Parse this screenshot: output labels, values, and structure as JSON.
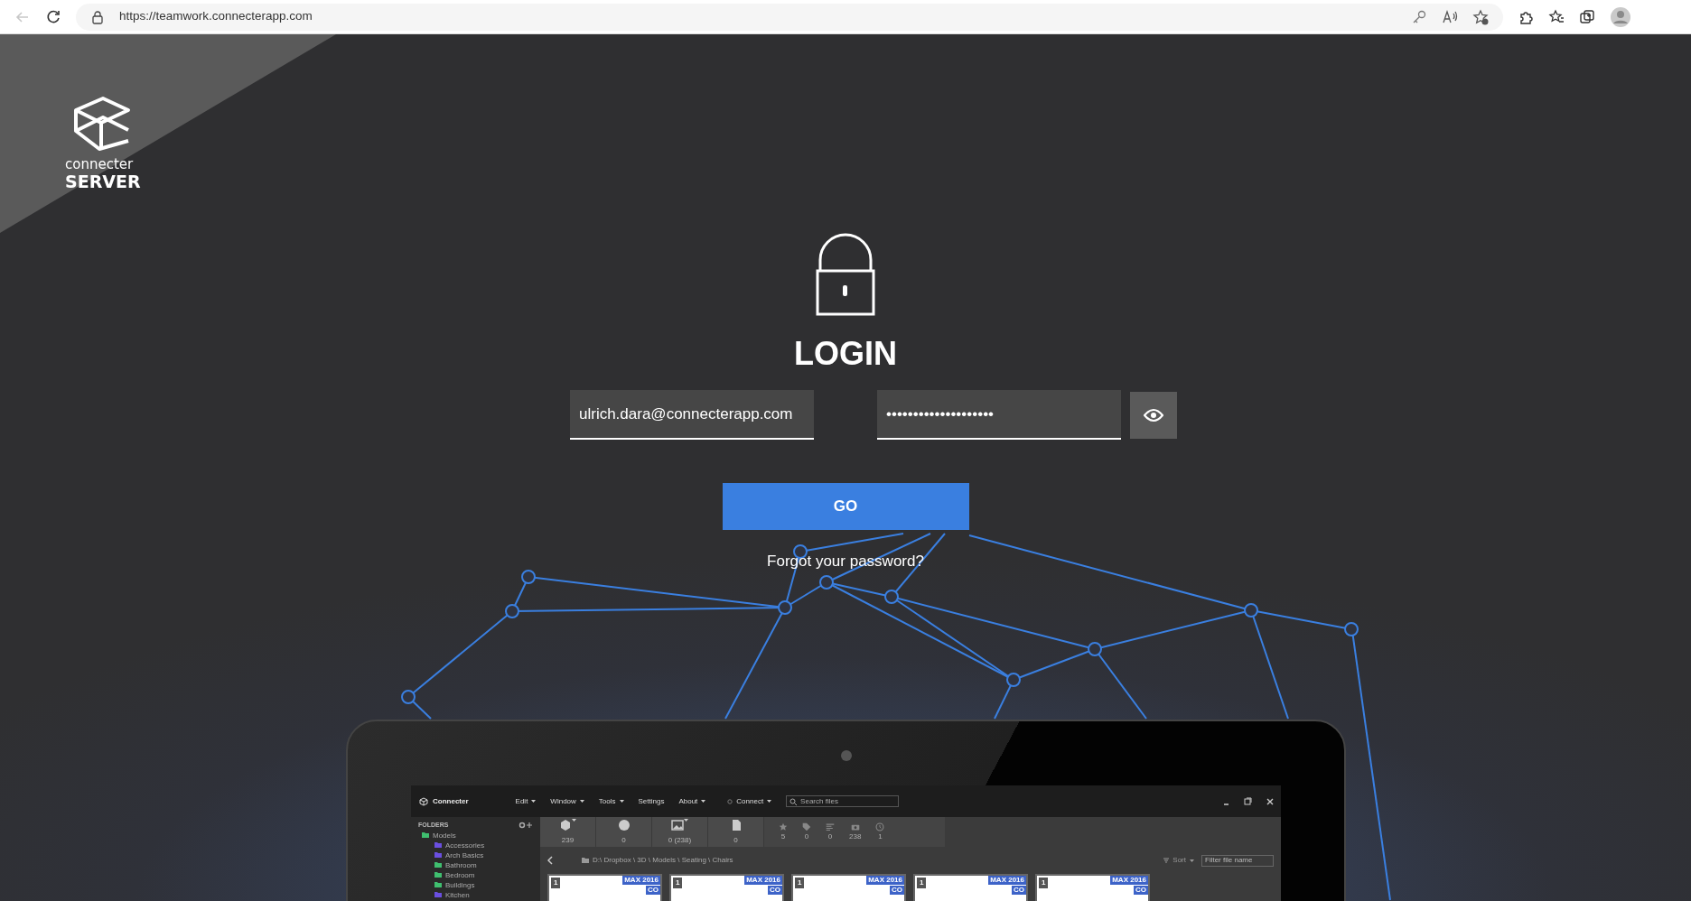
{
  "browser": {
    "back_disabled": true,
    "url": "https://teamwork.connecterapp.com"
  },
  "logo": {
    "name": "connecter",
    "product": "SERVER"
  },
  "login": {
    "title": "LOGIN",
    "email_value": "ulrich.dara@connecterapp.com",
    "password_mask": "••••••••••••••••••••",
    "submit": "GO",
    "forgot_link": "Forgot your password?"
  },
  "app_preview": {
    "app_name": "Connecter",
    "menu": [
      {
        "label": "Edit",
        "has_menu": true
      },
      {
        "label": "Window",
        "has_menu": true
      },
      {
        "label": "Tools",
        "has_menu": true
      },
      {
        "label": "Settings",
        "has_menu": false
      },
      {
        "label": "About",
        "has_menu": true
      }
    ],
    "connect": "Connect",
    "search_placeholder": "Search files",
    "folders_title": "FOLDERS",
    "folders": [
      {
        "label": "Models",
        "color": "#3fbf6f",
        "children": [
          {
            "label": "Accessories",
            "color": "#6a4fe0"
          },
          {
            "label": "Arch Basics",
            "color": "#6a4fe0"
          },
          {
            "label": "Bathroom",
            "color": "#3fbf6f"
          },
          {
            "label": "Bedroom",
            "color": "#3fbf6f"
          },
          {
            "label": "Buildings",
            "color": "#3fbf6f"
          },
          {
            "label": "Kitchen",
            "color": "#6a4fe0"
          }
        ]
      }
    ],
    "counters": [
      {
        "kind": "cube",
        "count": "239",
        "has_menu": true
      },
      {
        "kind": "sphere",
        "count": "0",
        "has_menu": false
      },
      {
        "kind": "image",
        "count": "0 (238)",
        "has_menu": true
      },
      {
        "kind": "document",
        "count": "0",
        "has_menu": false
      }
    ],
    "filters": [
      {
        "kind": "star",
        "count": "5"
      },
      {
        "kind": "tag",
        "count": "0"
      },
      {
        "kind": "bars",
        "count": "0"
      },
      {
        "kind": "camera",
        "count": "238"
      },
      {
        "kind": "clock",
        "count": "1"
      }
    ],
    "breadcrumb": "D:\\ Dropbox \\ 3D \\ Models \\ Seating \\ Chairs",
    "sort": "Sort",
    "filter_placeholder": "Filter file name",
    "thumbnails": [
      {
        "number": "1",
        "version": "MAX 2016",
        "tag": "CO"
      },
      {
        "number": "1",
        "version": "MAX 2016",
        "tag": "CO"
      },
      {
        "number": "1",
        "version": "MAX 2016",
        "tag": "CO"
      },
      {
        "number": "1",
        "version": "MAX 2016",
        "tag": "CO"
      },
      {
        "number": "1",
        "version": "MAX 2016",
        "tag": "CO"
      }
    ]
  }
}
